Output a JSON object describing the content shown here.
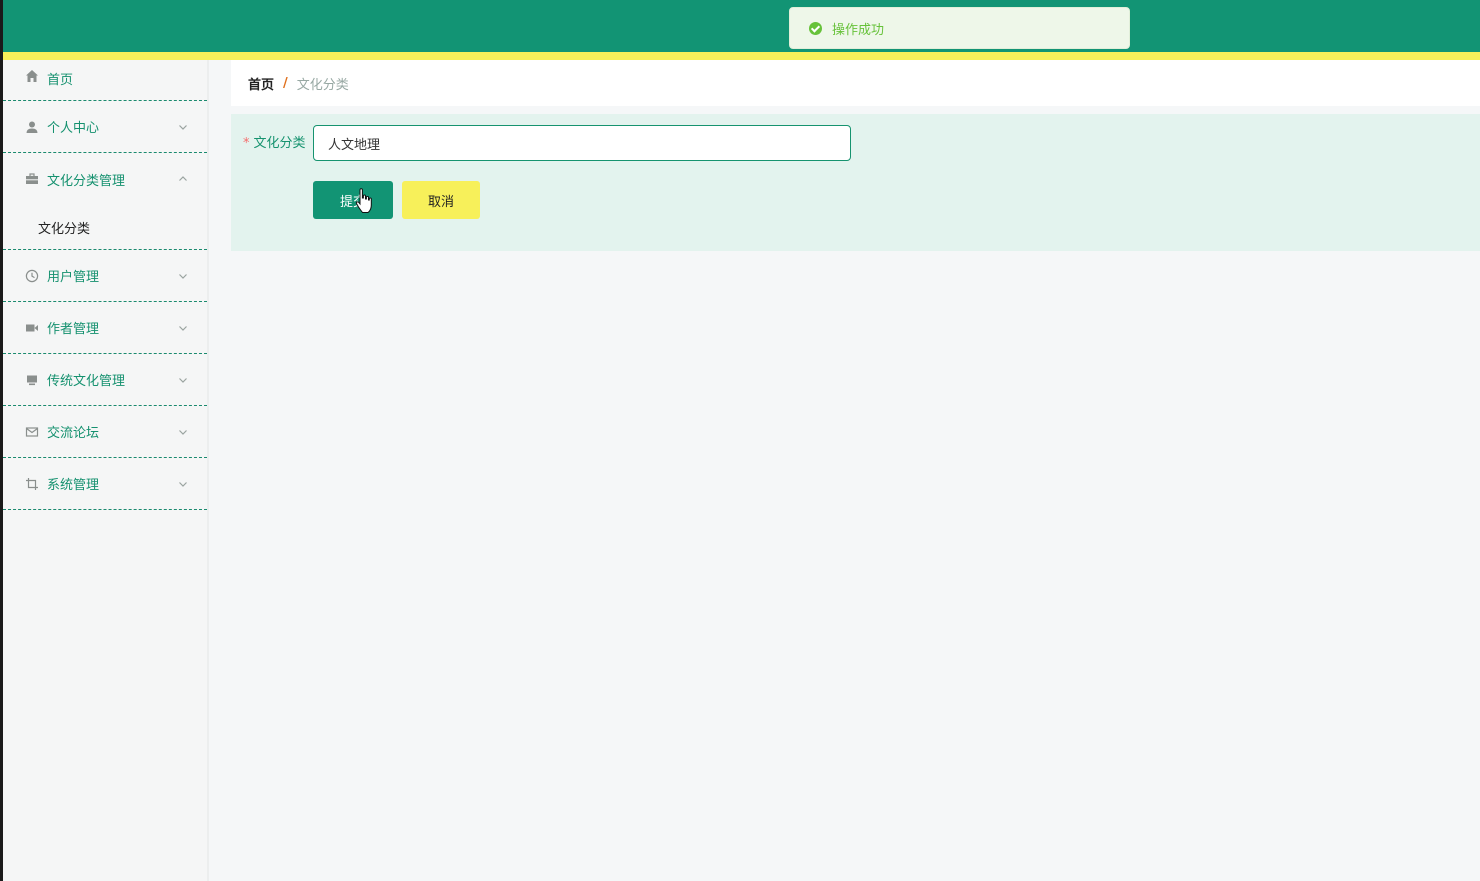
{
  "toast": {
    "message": "操作成功",
    "icon": "check-circle-icon"
  },
  "sidebar": {
    "items": [
      {
        "label": "首页",
        "icon": "home-icon"
      },
      {
        "label": "个人中心",
        "icon": "user-icon"
      },
      {
        "label": "文化分类管理",
        "icon": "briefcase-icon",
        "expanded": true,
        "children": [
          {
            "label": "文化分类"
          }
        ]
      },
      {
        "label": "用户管理",
        "icon": "clock-icon"
      },
      {
        "label": "作者管理",
        "icon": "video-camera-icon"
      },
      {
        "label": "传统文化管理",
        "icon": "monitor-icon"
      },
      {
        "label": "交流论坛",
        "icon": "mail-icon"
      },
      {
        "label": "系统管理",
        "icon": "crop-icon"
      }
    ]
  },
  "breadcrumb": {
    "home": "首页",
    "separator": "/",
    "current": "文化分类"
  },
  "form": {
    "required_mark": "*",
    "label": "文化分类",
    "value": "人文地理",
    "submit_label": "提交",
    "cancel_label": "取消"
  },
  "colors": {
    "primary": "#129474",
    "accent_yellow": "#f7f05a",
    "success": "#67c23a",
    "panel_bg": "#e3f3ee"
  }
}
